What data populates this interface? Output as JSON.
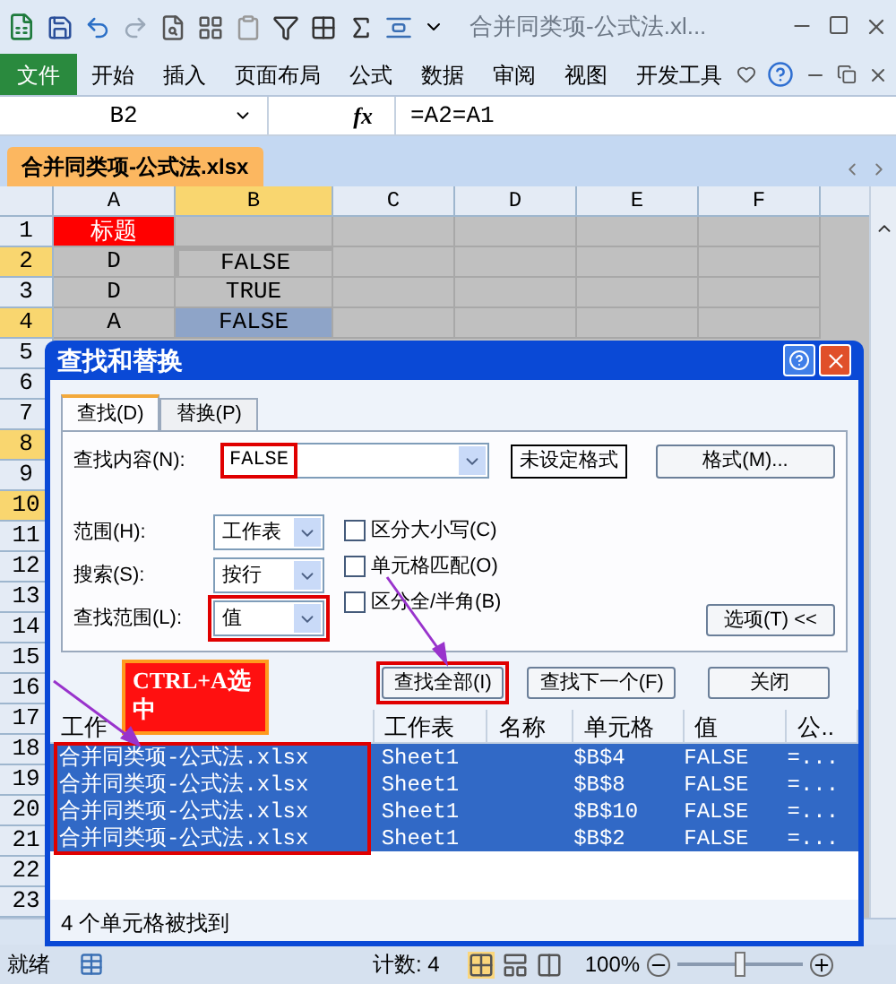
{
  "title_bar": {
    "title": "合并同类项-公式法.xl..."
  },
  "ribbon": {
    "file_tab": "文件",
    "tabs": [
      {
        "label": "开始"
      },
      {
        "label": "插入"
      },
      {
        "label": "页面布局"
      },
      {
        "label": "公式"
      },
      {
        "label": "数据"
      },
      {
        "label": "审阅"
      },
      {
        "label": "视图"
      },
      {
        "label": "开发工具"
      }
    ]
  },
  "formula_bar": {
    "name_box": "B2",
    "fx": "fx",
    "formula": "=A2=A1"
  },
  "workbook_tab": "合并同类项-公式法.xlsx",
  "sheet": {
    "columns": [
      {
        "label": "A",
        "selected": false
      },
      {
        "label": "B",
        "selected": true
      },
      {
        "label": "C",
        "selected": false
      },
      {
        "label": "D",
        "selected": false
      },
      {
        "label": "E",
        "selected": false
      },
      {
        "label": "F",
        "selected": false
      }
    ],
    "rows": [
      {
        "number": "1",
        "selected": false,
        "a": {
          "text": "标题",
          "kind": "title"
        }
      },
      {
        "number": "2",
        "selected": true,
        "a": {
          "text": "D",
          "kind": "plain"
        },
        "b": {
          "text": "FALSE",
          "kind": "active"
        }
      },
      {
        "number": "3",
        "selected": false,
        "a": {
          "text": "D",
          "kind": "plain"
        },
        "b": {
          "text": "TRUE",
          "kind": "plain"
        }
      },
      {
        "number": "4",
        "selected": true,
        "a": {
          "text": "A",
          "kind": "plain"
        },
        "b": {
          "text": "FALSE",
          "kind": "selected"
        }
      },
      {
        "number": "5",
        "selected": false
      },
      {
        "number": "6",
        "selected": false
      },
      {
        "number": "7",
        "selected": false
      },
      {
        "number": "8",
        "selected": true
      },
      {
        "number": "9",
        "selected": false
      },
      {
        "number": "10",
        "selected": true
      },
      {
        "number": "11",
        "selected": false
      },
      {
        "number": "12",
        "selected": false
      },
      {
        "number": "13",
        "selected": false
      },
      {
        "number": "14",
        "selected": false
      },
      {
        "number": "15",
        "selected": false
      },
      {
        "number": "16",
        "selected": false
      },
      {
        "number": "17",
        "selected": false
      },
      {
        "number": "18",
        "selected": false
      },
      {
        "number": "19",
        "selected": false
      },
      {
        "number": "20",
        "selected": false
      },
      {
        "number": "21",
        "selected": false
      },
      {
        "number": "22",
        "selected": false
      },
      {
        "number": "23",
        "selected": false
      }
    ]
  },
  "dialog": {
    "title": "查找和替换",
    "tabs": [
      {
        "label": "查找(D)",
        "selected": true
      },
      {
        "label": "替换(P)",
        "selected": false
      }
    ],
    "find_label": "查找内容(N):",
    "find_value": "FALSE",
    "format_status": "未设定格式",
    "format_button": "格式(M)...",
    "dropdowns": [
      {
        "label": "范围(H):",
        "value": "工作表"
      },
      {
        "label": "搜索(S):",
        "value": "按行"
      },
      {
        "label": "查找范围(L):",
        "value": "值"
      }
    ],
    "checkboxes": [
      {
        "label": "区分大小写(C)",
        "checked": false
      },
      {
        "label": "单元格匹配(O)",
        "checked": false
      },
      {
        "label": "区分全/半角(B)",
        "checked": false
      }
    ],
    "options_button": "选项(T) <<",
    "buttons": [
      "查找全部(I)",
      "查找下一个(F)",
      "关闭"
    ],
    "results": {
      "columns": [
        "工作",
        "工作表",
        "名称",
        "单元格",
        "值",
        "公.."
      ],
      "rows": [
        {
          "book": "合并同类项-公式法.xlsx",
          "sheet": "Sheet1",
          "cell": "$B$4",
          "value": "FALSE",
          "formula": "=...",
          "selected": true
        },
        {
          "book": "合并同类项-公式法.xlsx",
          "sheet": "Sheet1",
          "cell": "$B$8",
          "value": "FALSE",
          "formula": "=...",
          "selected": true
        },
        {
          "book": "合并同类项-公式法.xlsx",
          "sheet": "Sheet1",
          "cell": "$B$10",
          "value": "FALSE",
          "formula": "=...",
          "selected": true
        },
        {
          "book": "合并同类项-公式法.xlsx",
          "sheet": "Sheet1",
          "cell": "$B$2",
          "value": "FALSE",
          "formula": "=...",
          "selected": true
        }
      ]
    },
    "status": "4 个单元格被找到"
  },
  "annotation": {
    "callout": "CTRL+A选中"
  },
  "status_bar": {
    "status": "就绪",
    "count": "计数: 4",
    "zoom": "100%",
    "zoom_slider": {
      "level": 0.5
    }
  }
}
